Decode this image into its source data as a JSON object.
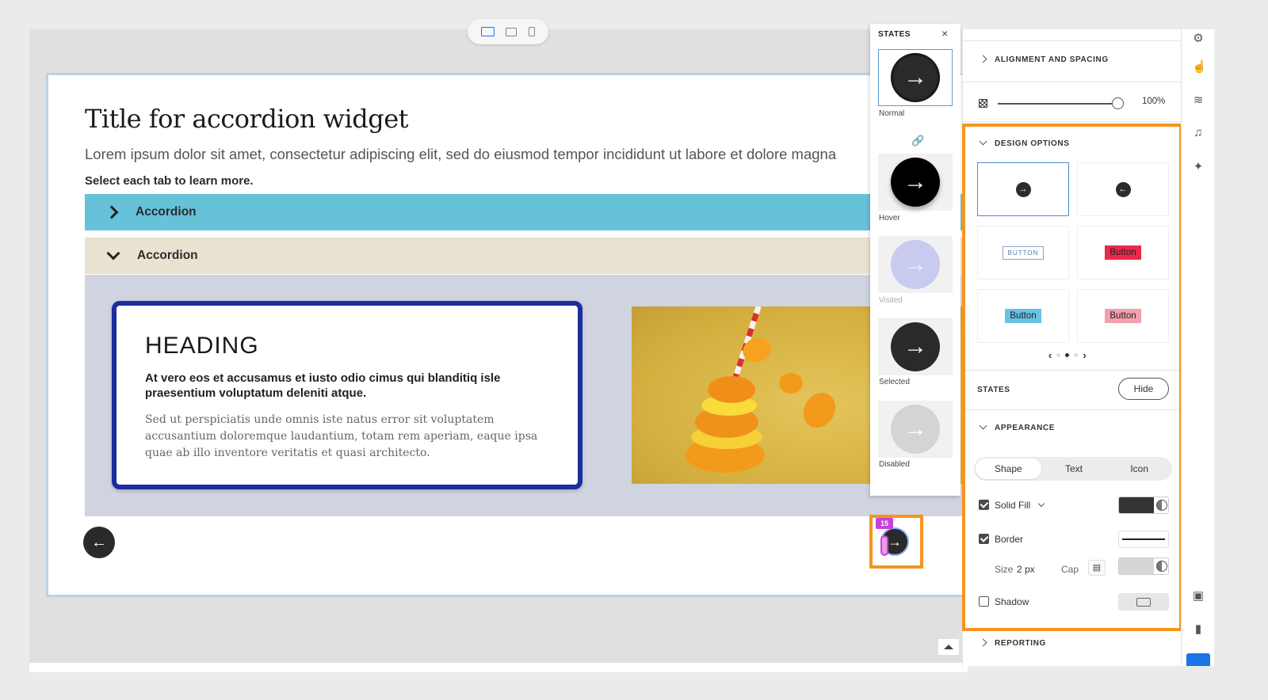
{
  "slide": {
    "title": "Title for accordion widget",
    "subtitle": "Lorem ipsum dolor sit amet, consectetur adipiscing elit, sed do eiusmod tempor incididunt ut labore et dolore magna",
    "instruction": "Select each tab to learn more.",
    "accordions": [
      {
        "label": "Accordion",
        "state": "collapsed",
        "color": "#66c2d9"
      },
      {
        "label": "Accordion",
        "state": "expanded",
        "color": "#e9e2d2"
      }
    ],
    "card": {
      "heading": "HEADING",
      "lead": "At vero eos et accusamus et iusto odio cimus qui blanditiq isle praesentium voluptatum deleniti atque.",
      "body": "Sed ut perspiciatis unde omnis iste natus error sit voluptatem accusantium doloremque laudantium, totam rem aperiam, eaque ipsa quae ab illo inventore veritatis et quasi architecto."
    },
    "prev_icon": "←",
    "next_icon": "→",
    "next_badge": "15"
  },
  "device_bar": [
    "desktop-icon",
    "tablet-icon",
    "phone-icon"
  ],
  "states_panel": {
    "title": "STATES",
    "close": "×",
    "arrow": "→",
    "states": [
      {
        "label": "Normal",
        "color": "#2a2a2a"
      },
      {
        "label": "Hover",
        "color": "#000000"
      },
      {
        "label": "Visited",
        "color": "#c9caf0"
      },
      {
        "label": "Selected",
        "color": "#2a2a2a"
      },
      {
        "label": "Disabled",
        "color": "#d4d4d4"
      }
    ]
  },
  "properties": {
    "alignment_title": "ALIGNMENT AND SPACING",
    "opacity_value": "100%",
    "design_options_title": "DESIGN OPTIONS",
    "design_options": [
      {
        "type": "icon",
        "label": "→"
      },
      {
        "type": "icon",
        "label": "←"
      },
      {
        "type": "text",
        "label": "BUTTON"
      },
      {
        "type": "text",
        "label": "Button",
        "bg": "#e8294b"
      },
      {
        "type": "text",
        "label": "Button",
        "bg": "#67c3e6"
      },
      {
        "type": "text",
        "label": "Button",
        "bg": "#f2a0ae"
      }
    ],
    "pager_prev": "‹",
    "pager_next": "›",
    "states_title": "STATES",
    "hide_label": "Hide",
    "appearance_title": "APPEARANCE",
    "tabs": [
      "Shape",
      "Text",
      "Icon"
    ],
    "solid_fill_label": "Solid Fill",
    "solid_fill_color": "#333333",
    "border_label": "Border",
    "size_label": "Size",
    "size_value": "2 px",
    "cap_label": "Cap",
    "border_color": "#d6d6d6",
    "shadow_label": "Shadow",
    "reporting_title": "REPORTING"
  },
  "rail_icons": [
    "sliders-icon",
    "touch-icon",
    "animation-icon",
    "music-icon",
    "accessibility-icon",
    "panel-icon",
    "document-icon"
  ]
}
